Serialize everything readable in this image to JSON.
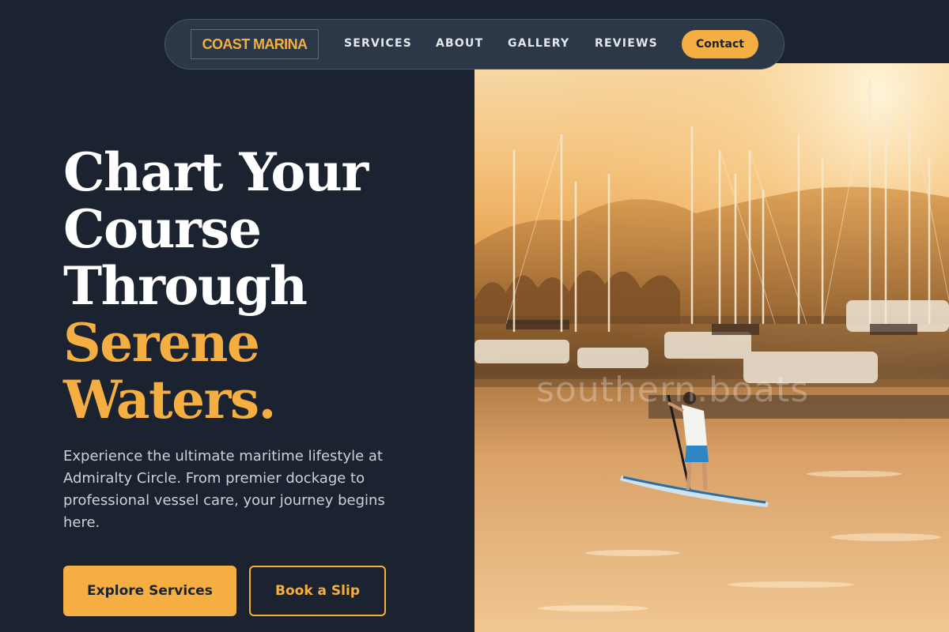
{
  "nav": {
    "logo": "COAST MARINA",
    "links": [
      "SERVICES",
      "ABOUT",
      "GALLERY",
      "REVIEWS"
    ],
    "contact_label": "Contact"
  },
  "hero": {
    "headline_white": [
      "Chart Your",
      "Course",
      "Through"
    ],
    "headline_accent": [
      "Serene",
      "Waters."
    ],
    "lede": "Experience the ultimate maritime lifestyle at Admiralty Circle. From premier dockage to professional vessel care, your journey begins here.",
    "primary_cta": "Explore Services",
    "secondary_cta": "Book a Slip"
  },
  "image": {
    "watermark": "southern.boats",
    "subject": "paddleboarder in marina at sunset"
  },
  "colors": {
    "background": "#1b2230",
    "accent": "#f5ae41",
    "nav_bg": "#2c3847"
  }
}
